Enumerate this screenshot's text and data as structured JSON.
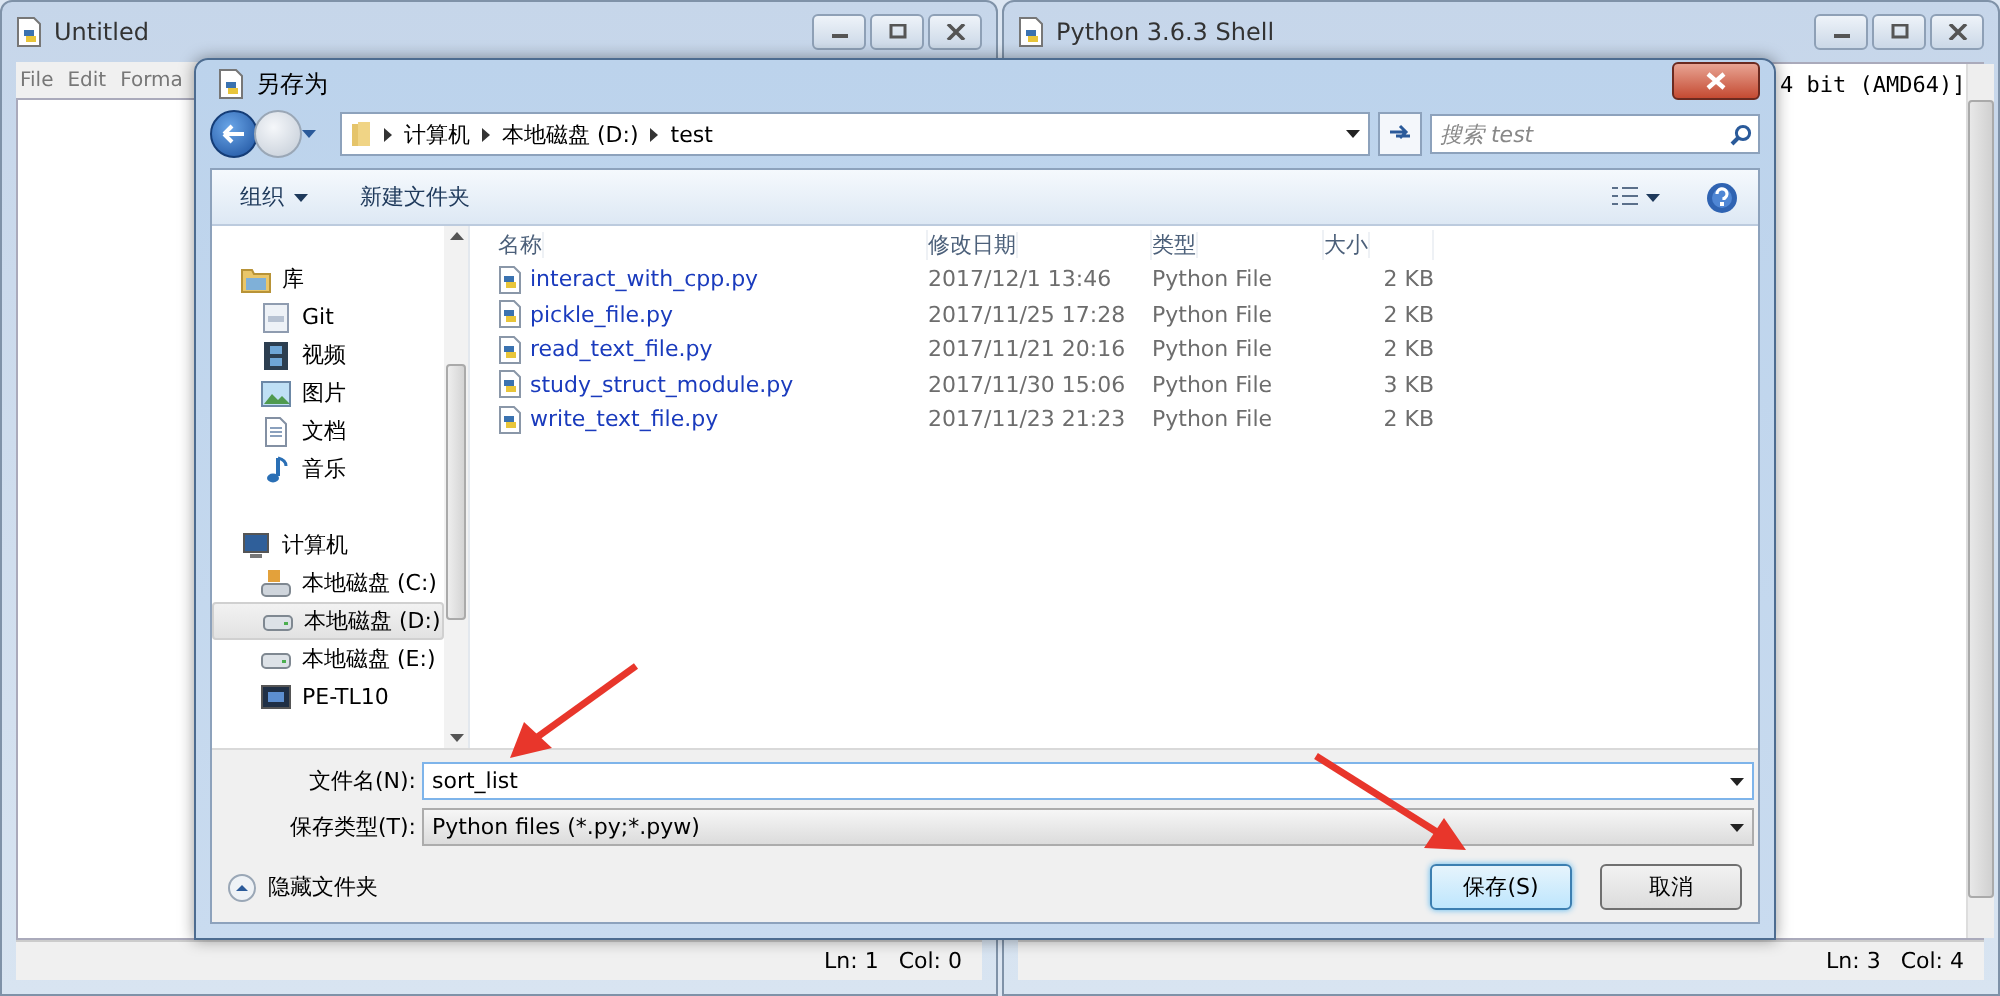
{
  "windows": [
    {
      "title": "Untitled",
      "menu": [
        "File",
        "Edit",
        "Forma"
      ],
      "status": [
        "Ln: 1",
        "Col: 0"
      ]
    },
    {
      "title": "Python 3.6.3 Shell",
      "text": "4 bit (AMD64)]",
      "status": [
        "Ln: 3",
        "Col: 4"
      ]
    }
  ],
  "dialog": {
    "title": "另存为",
    "breadcrumb": [
      "计算机",
      "本地磁盘 (D:)",
      "test"
    ],
    "search": {
      "placeholder": "搜索 test"
    },
    "toolbar": [
      "组织",
      "新建文件夹"
    ],
    "nav": [
      {
        "label": "库",
        "kind": "library",
        "selected": false,
        "children": [
          {
            "label": "Git",
            "kind": "git",
            "selected": false
          },
          {
            "label": "视频",
            "kind": "video",
            "selected": false
          },
          {
            "label": "图片",
            "kind": "picture",
            "selected": false
          },
          {
            "label": "文档",
            "kind": "document",
            "selected": false
          },
          {
            "label": "音乐",
            "kind": "music",
            "selected": false
          }
        ]
      },
      {
        "label": "计算机",
        "kind": "computer",
        "selected": false,
        "children": [
          {
            "label": "本地磁盘 (C:)",
            "kind": "system-drive",
            "selected": false
          },
          {
            "label": "本地磁盘 (D:)",
            "kind": "drive",
            "selected": true
          },
          {
            "label": "本地磁盘 (E:)",
            "kind": "drive",
            "selected": false
          },
          {
            "label": "PE-TL10",
            "kind": "device",
            "selected": false
          }
        ]
      }
    ],
    "columns": [
      "名称",
      "修改日期",
      "类型",
      "大小"
    ],
    "files": [
      {
        "name": "interact_with_cpp.py",
        "modified": "2017/12/1 13:46",
        "type": "Python File",
        "size": "2 KB"
      },
      {
        "name": "pickle_file.py",
        "modified": "2017/11/25 17:28",
        "type": "Python File",
        "size": "2 KB"
      },
      {
        "name": "read_text_file.py",
        "modified": "2017/11/21 20:16",
        "type": "Python File",
        "size": "2 KB"
      },
      {
        "name": "study_struct_module.py",
        "modified": "2017/11/30 15:06",
        "type": "Python File",
        "size": "3 KB"
      },
      {
        "name": "write_text_file.py",
        "modified": "2017/11/23 21:23",
        "type": "Python File",
        "size": "2 KB"
      }
    ],
    "filename": {
      "label": "文件名(N):",
      "value": "sort_list"
    },
    "filetype": {
      "label": "保存类型(T):",
      "value": "Python files (*.py;*.pyw)"
    },
    "hide_folders": "隐藏文件夹",
    "buttons": [
      {
        "label": "保存(S)",
        "default": true
      },
      {
        "label": "取消",
        "default": false
      }
    ]
  }
}
